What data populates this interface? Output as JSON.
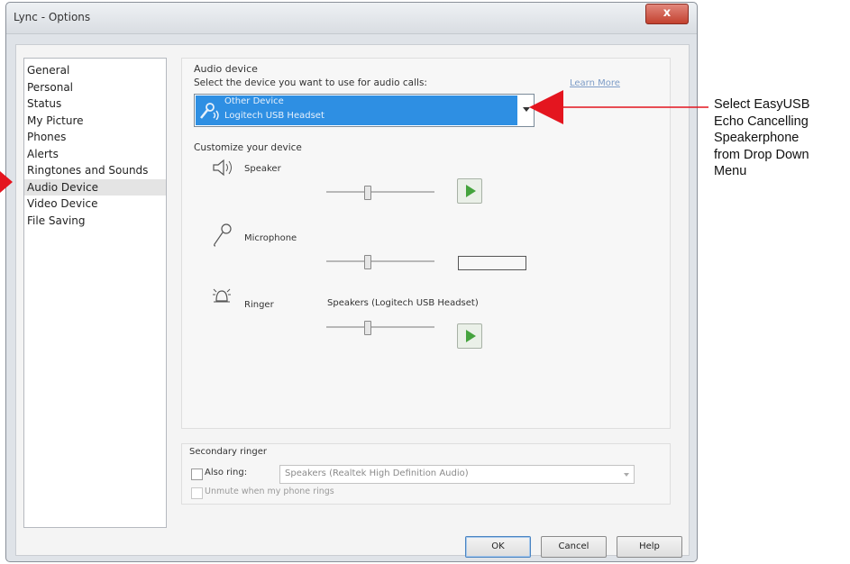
{
  "window": {
    "title": "Lync - Options",
    "close_label": "x"
  },
  "nav": {
    "items": [
      {
        "label": "General"
      },
      {
        "label": "Personal"
      },
      {
        "label": "Status"
      },
      {
        "label": "My Picture"
      },
      {
        "label": "Phones"
      },
      {
        "label": "Alerts"
      },
      {
        "label": "Ringtones and Sounds"
      },
      {
        "label": "Audio Device",
        "selected": true
      },
      {
        "label": "Video Device"
      },
      {
        "label": "File Saving"
      }
    ]
  },
  "audio": {
    "section_label": "Audio device",
    "prompt": "Select the device you want to use for audio calls:",
    "learn_more": "Learn More",
    "selected_device": {
      "line1": "Other Device",
      "line2": "Logitech USB Headset"
    },
    "customize_label": "Customize your device",
    "speaker": {
      "label": "Speaker"
    },
    "microphone": {
      "label": "Microphone"
    },
    "ringer": {
      "label": "Ringer",
      "device": "Speakers (Logitech USB Headset)"
    }
  },
  "secondary": {
    "group_label": "Secondary ringer",
    "also_ring_label": "Also ring:",
    "also_ring_value": "Speakers (Realtek High Definition Audio)",
    "unmute_label": "Unmute when my phone rings"
  },
  "buttons": {
    "ok": "OK",
    "cancel": "Cancel",
    "help": "Help"
  },
  "annotation": {
    "lines": [
      "Select EasyUSB",
      "Echo Cancelling",
      "Speakerphone",
      "from Drop Down",
      "Menu"
    ],
    "arrow_color": "#e4151f"
  }
}
